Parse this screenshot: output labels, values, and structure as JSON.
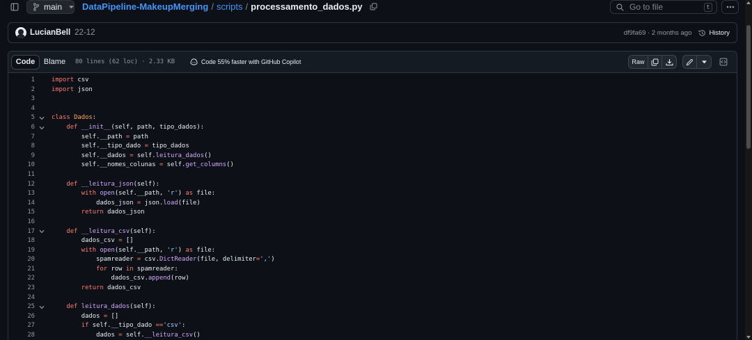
{
  "colors": {
    "background": "#0d1117",
    "accent_link": "#4493f8",
    "keyword": "#ff7b72",
    "function": "#d2a8ff",
    "string": "#a5d6ff",
    "class_name": "#ffa657"
  },
  "topbar": {
    "branch": "main",
    "repo": "DataPipeline-MakeupMerging",
    "sep1": "/",
    "dir": "scripts",
    "sep2": "/",
    "file": "processamento_dados.py",
    "goto_placeholder": "Go to file",
    "goto_shortcut": "t"
  },
  "commit": {
    "author": "LucianBell",
    "message": "22-12",
    "hash_time": "df9fa69 · 2 months ago",
    "history_label": "History"
  },
  "file_header": {
    "tab_code": "Code",
    "tab_blame": "Blame",
    "meta": "80 lines (62 loc) · 2.33 KB",
    "copilot": "Code 55% faster with GitHub Copilot",
    "raw": "Raw"
  },
  "code_lines": [
    {
      "n": "1",
      "fold": false,
      "tokens": [
        [
          "kw",
          "import"
        ],
        [
          "",
          "csv"
        ]
      ]
    },
    {
      "n": "2",
      "fold": false,
      "tokens": [
        [
          "kw",
          "import"
        ],
        [
          "",
          "json"
        ]
      ]
    },
    {
      "n": "3",
      "fold": false,
      "tokens": []
    },
    {
      "n": "4",
      "fold": false,
      "tokens": []
    },
    {
      "n": "5",
      "fold": true,
      "tokens": [
        [
          "kw",
          "class"
        ],
        [
          "cl",
          "Dados"
        ],
        [
          "",
          ":"
        ]
      ]
    },
    {
      "n": "6",
      "fold": true,
      "tokens": [
        [
          "",
          "    "
        ],
        [
          "kw",
          "def"
        ],
        [
          "fn",
          "__init__"
        ],
        [
          "",
          "(self, path, tipo_dados):"
        ]
      ]
    },
    {
      "n": "7",
      "fold": false,
      "tokens": [
        [
          "",
          "        self.__path "
        ],
        [
          "op",
          "="
        ],
        [
          "",
          " path"
        ]
      ]
    },
    {
      "n": "8",
      "fold": false,
      "tokens": [
        [
          "",
          "        self.__tipo_dado "
        ],
        [
          "op",
          "="
        ],
        [
          "",
          " tipo_dados"
        ]
      ]
    },
    {
      "n": "9",
      "fold": false,
      "tokens": [
        [
          "",
          "        self.__dados "
        ],
        [
          "op",
          "="
        ],
        [
          "",
          " self."
        ],
        [
          "fn",
          "leitura_dados"
        ],
        [
          "",
          "()"
        ]
      ]
    },
    {
      "n": "10",
      "fold": false,
      "tokens": [
        [
          "",
          "        self.__nomes_colunas "
        ],
        [
          "op",
          "="
        ],
        [
          "",
          " self."
        ],
        [
          "fn",
          "get_columns"
        ],
        [
          "",
          "()"
        ]
      ]
    },
    {
      "n": "11",
      "fold": false,
      "tokens": []
    },
    {
      "n": "12",
      "fold": false,
      "tokens": [
        [
          "",
          "    "
        ],
        [
          "kw",
          "def"
        ],
        [
          "fn",
          "__leitura_json"
        ],
        [
          "",
          "(self):"
        ]
      ]
    },
    {
      "n": "13",
      "fold": false,
      "tokens": [
        [
          "",
          "        "
        ],
        [
          "kw",
          "with"
        ],
        [
          "fn",
          "open"
        ],
        [
          "",
          "(self.__path, "
        ],
        [
          "st",
          "'r'"
        ],
        [
          "",
          ") "
        ],
        [
          "kw",
          "as"
        ],
        [
          "",
          " file:"
        ]
      ]
    },
    {
      "n": "14",
      "fold": false,
      "tokens": [
        [
          "",
          "            dados_json "
        ],
        [
          "op",
          "="
        ],
        [
          "",
          " json."
        ],
        [
          "fn",
          "load"
        ],
        [
          "",
          "(file)"
        ]
      ]
    },
    {
      "n": "15",
      "fold": false,
      "tokens": [
        [
          "",
          "        "
        ],
        [
          "kw",
          "return"
        ],
        [
          "",
          " dados_json"
        ]
      ]
    },
    {
      "n": "16",
      "fold": false,
      "tokens": []
    },
    {
      "n": "17",
      "fold": true,
      "tokens": [
        [
          "",
          "    "
        ],
        [
          "kw",
          "def"
        ],
        [
          "fn",
          "__leitura_csv"
        ],
        [
          "",
          "(self):"
        ]
      ]
    },
    {
      "n": "18",
      "fold": false,
      "tokens": [
        [
          "",
          "        dados_csv "
        ],
        [
          "op",
          "="
        ],
        [
          "",
          " []"
        ]
      ]
    },
    {
      "n": "19",
      "fold": false,
      "tokens": [
        [
          "",
          "        "
        ],
        [
          "kw",
          "with"
        ],
        [
          "fn",
          "open"
        ],
        [
          "",
          "(self.__path, "
        ],
        [
          "st",
          "'r'"
        ],
        [
          "",
          ") "
        ],
        [
          "kw",
          "as"
        ],
        [
          "",
          " file:"
        ]
      ]
    },
    {
      "n": "20",
      "fold": false,
      "tokens": [
        [
          "",
          "            spamreader "
        ],
        [
          "op",
          "="
        ],
        [
          "",
          " csv."
        ],
        [
          "fn",
          "DictReader"
        ],
        [
          "",
          "(file, delimiter"
        ],
        [
          "op",
          "="
        ],
        [
          "st",
          "','"
        ],
        [
          "",
          ")"
        ]
      ]
    },
    {
      "n": "21",
      "fold": false,
      "tokens": [
        [
          "",
          "            "
        ],
        [
          "kw",
          "for"
        ],
        [
          "",
          " row "
        ],
        [
          "kw",
          "in"
        ],
        [
          "",
          " spamreader:"
        ]
      ]
    },
    {
      "n": "22",
      "fold": false,
      "tokens": [
        [
          "",
          "                dados_csv."
        ],
        [
          "fn",
          "append"
        ],
        [
          "",
          "(row)"
        ]
      ]
    },
    {
      "n": "23",
      "fold": false,
      "tokens": [
        [
          "",
          "        "
        ],
        [
          "kw",
          "return"
        ],
        [
          "",
          " dados_csv"
        ]
      ]
    },
    {
      "n": "24",
      "fold": false,
      "tokens": []
    },
    {
      "n": "25",
      "fold": true,
      "tokens": [
        [
          "",
          "    "
        ],
        [
          "kw",
          "def"
        ],
        [
          "fn",
          "leitura_dados"
        ],
        [
          "",
          "(self):"
        ]
      ]
    },
    {
      "n": "26",
      "fold": false,
      "tokens": [
        [
          "",
          "        dados "
        ],
        [
          "op",
          "="
        ],
        [
          "",
          " []"
        ]
      ]
    },
    {
      "n": "27",
      "fold": false,
      "tokens": [
        [
          "",
          "        "
        ],
        [
          "kw",
          "if"
        ],
        [
          "",
          " self.__tipo_dado "
        ],
        [
          "op",
          "=="
        ],
        [
          " ",
          ""
        ],
        [
          "st",
          "'csv'"
        ],
        [
          "",
          ":"
        ]
      ]
    },
    {
      "n": "28",
      "fold": false,
      "tokens": [
        [
          "",
          "            dados "
        ],
        [
          "op",
          "="
        ],
        [
          "",
          " self."
        ],
        [
          "fn",
          "__leitura_csv"
        ],
        [
          "",
          "()"
        ]
      ]
    }
  ]
}
